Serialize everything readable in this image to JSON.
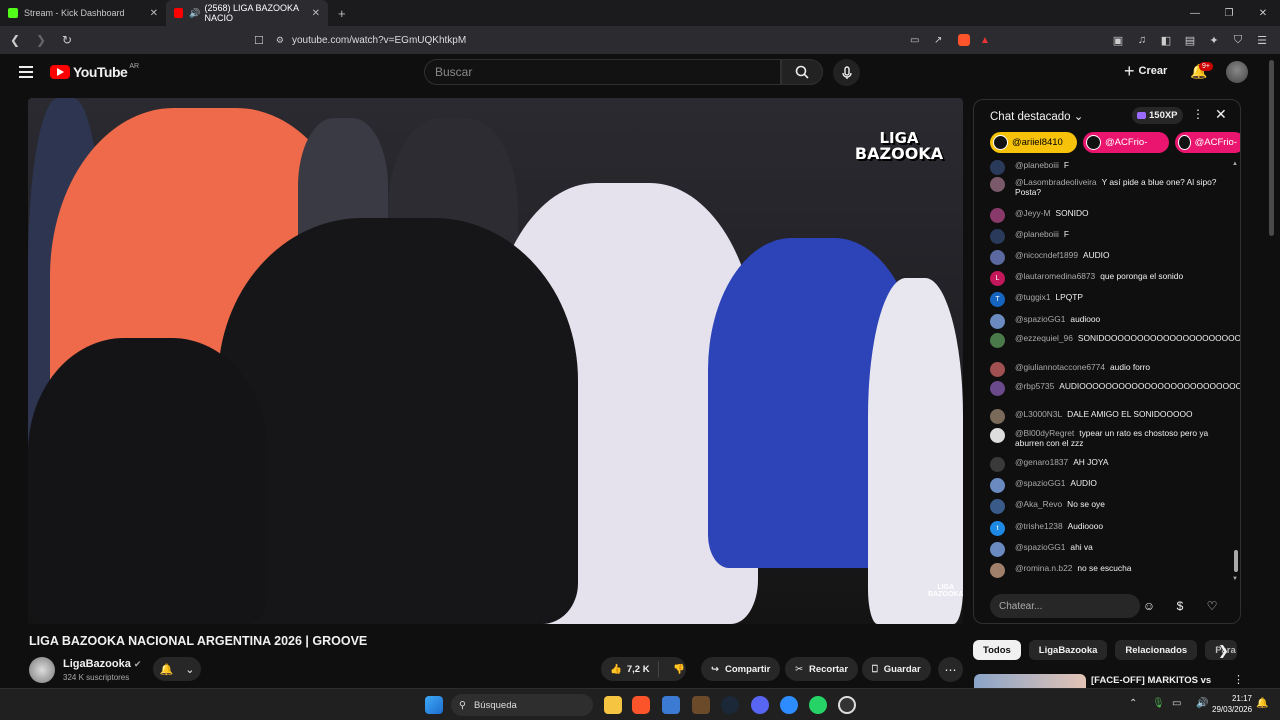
{
  "browser": {
    "tabs": [
      {
        "title": "Stream - Kick Dashboard",
        "active": false
      },
      {
        "title": "(2568) LIGA BAZOOKA NACIO",
        "active": true
      }
    ],
    "url": "youtube.com/watch?v=EGmUQKhtkpM"
  },
  "youtube": {
    "logo_text": "YouTube",
    "logo_country": "AR",
    "search_placeholder": "Buscar",
    "create_label": "Crear",
    "notification_count": "9+"
  },
  "video": {
    "overlay_logo_line1": "LIGA",
    "overlay_logo_line2": "BAZOOKA",
    "title": "LIGA BAZOOKA NACIONAL ARGENTINA 2026 | GROOVE",
    "channel_name": "LigaBazooka",
    "subscribers": "324 K suscriptores",
    "likes": "7,2 K",
    "share_label": "Compartir",
    "clip_label": "Recortar",
    "save_label": "Guardar"
  },
  "chat": {
    "title": "Chat destacado",
    "xp": "150XP",
    "pinned": [
      {
        "user": "@ariiel8410",
        "color": "#f7c20a"
      },
      {
        "user": "@ACFrio-",
        "color": "#e9156e"
      },
      {
        "user": "@ACFrio-",
        "color": "#e9156e"
      }
    ],
    "messages": [
      {
        "user": "@planeboiii",
        "text": "F",
        "avatar": "#2a3a5a"
      },
      {
        "user": "@Lasombradeoliveira",
        "text": "Y así pide a blue one? Al sipo? Posta?",
        "avatar": "#7a5a6a"
      },
      {
        "user": "@Jeyy-M",
        "text": "SONIDO",
        "avatar": "#8a3a6a"
      },
      {
        "user": "@planeboiii",
        "text": "F",
        "avatar": "#2a3a5a"
      },
      {
        "user": "@nicocndef1899",
        "text": "AUDIO",
        "avatar": "#5a6aa0"
      },
      {
        "user": "@lautaromedina6873",
        "text": "que poronga el sonido",
        "avatar": "#c2185b",
        "initial": "L"
      },
      {
        "user": "@tuggix1",
        "text": "LPQTP",
        "avatar": "#1565c0",
        "initial": "T"
      },
      {
        "user": "@spazioGG1",
        "text": "audiooo",
        "avatar": "#6a8ac0"
      },
      {
        "user": "@ezzequiel_96",
        "text": "SONIDOOOOOOOOOOOOOOOOOOOOOOOOOO",
        "avatar": "#4a7a4a"
      },
      {
        "user": "@giuliannotaccone6774",
        "text": "audio forro",
        "avatar": "#a05050"
      },
      {
        "user": "@rbp5735",
        "text": "AUDIOOOOOOOOOOOOOOOOOOOOOOOOOOOO",
        "avatar": "#6a4a8a"
      },
      {
        "user": "@L3000N3L",
        "text": "DALE AMIGO EL SONIDOOOOO",
        "avatar": "#7a6a5a"
      },
      {
        "user": "@Bl00dyRegret",
        "text": "typear un rato es chostoso pero ya aburren con el zzz",
        "avatar": "#ddd"
      },
      {
        "user": "@genaro1837",
        "text": "AH JOYA",
        "avatar": "#3a3a3a"
      },
      {
        "user": "@spazioGG1",
        "text": "AUDIO",
        "avatar": "#6a8ac0"
      },
      {
        "user": "@Aka_Revo",
        "text": "No se oye",
        "avatar": "#3a5a8a"
      },
      {
        "user": "@trishe1238",
        "text": "Audioooo",
        "avatar": "#1e88e5",
        "initial": "t"
      },
      {
        "user": "@spazioGG1",
        "text": "ahi va",
        "avatar": "#6a8ac0"
      },
      {
        "user": "@romina.n.b22",
        "text": "no se escucha",
        "avatar": "#a0806a"
      }
    ],
    "input_placeholder": "Chatear..."
  },
  "chips": [
    "Todos",
    "LigaBazooka",
    "Relacionados",
    "Para t"
  ],
  "recommendation": {
    "title": "[FACE-OFF] MARKITOS vs"
  },
  "taskbar": {
    "search_label": "Búsqueda",
    "time": "21:17",
    "date": "29/03/2026"
  }
}
